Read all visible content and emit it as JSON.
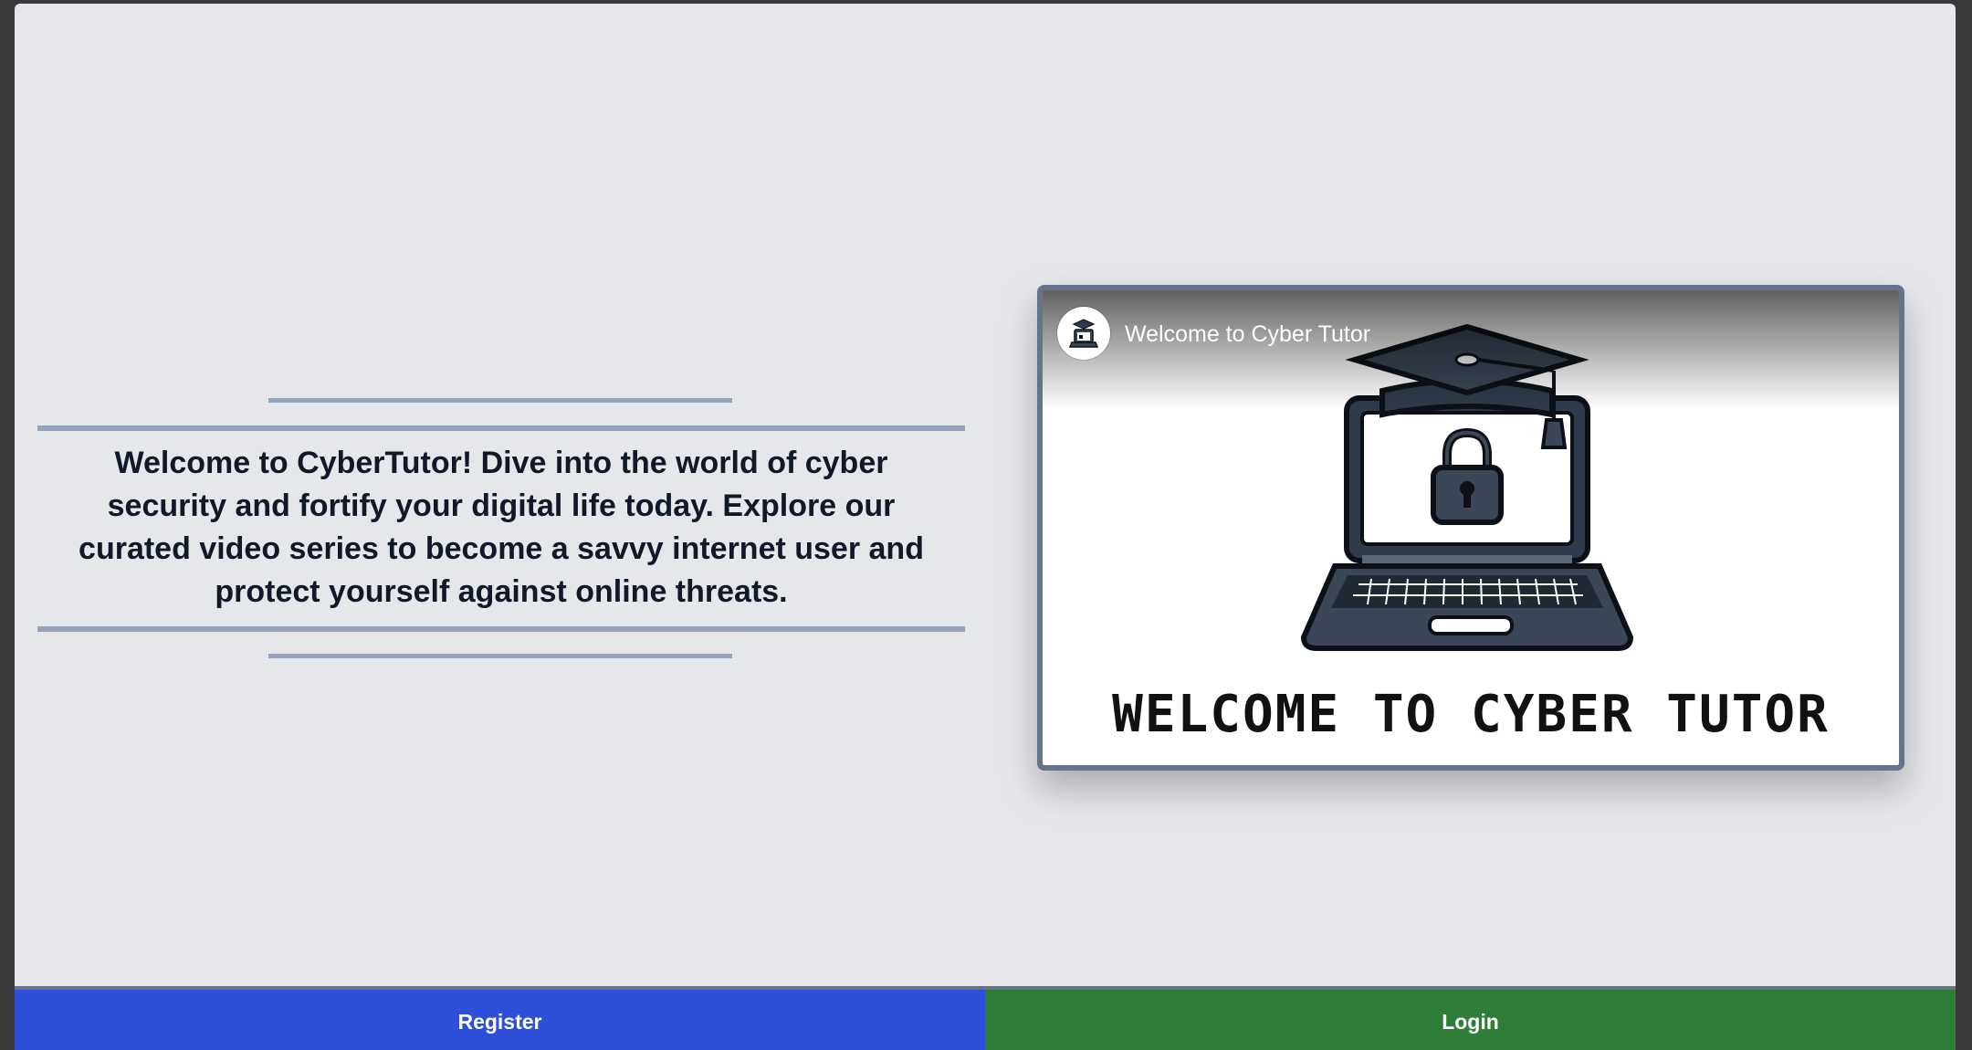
{
  "intro": {
    "text": "Welcome to CyberTutor! Dive into the world of cyber security and fortify your digital life today. Explore our curated video series to become a savvy internet user and protect yourself against online threats."
  },
  "video": {
    "title": "Welcome to Cyber Tutor",
    "thumbnail_caption": "WELCOME TO CYBER TUTOR",
    "channel_icon": "laptop-graduation-cap-icon",
    "thumbnail_icons": [
      "graduation-cap-icon",
      "laptop-icon",
      "padlock-icon"
    ]
  },
  "actions": {
    "register_label": "Register",
    "login_label": "Login"
  },
  "colors": {
    "page_background": "#e5e7eb",
    "rule": "#94a3b8",
    "text": "#111827",
    "register": "#2d4fd9",
    "login": "#2e7d38",
    "video_border": "#64748b"
  }
}
